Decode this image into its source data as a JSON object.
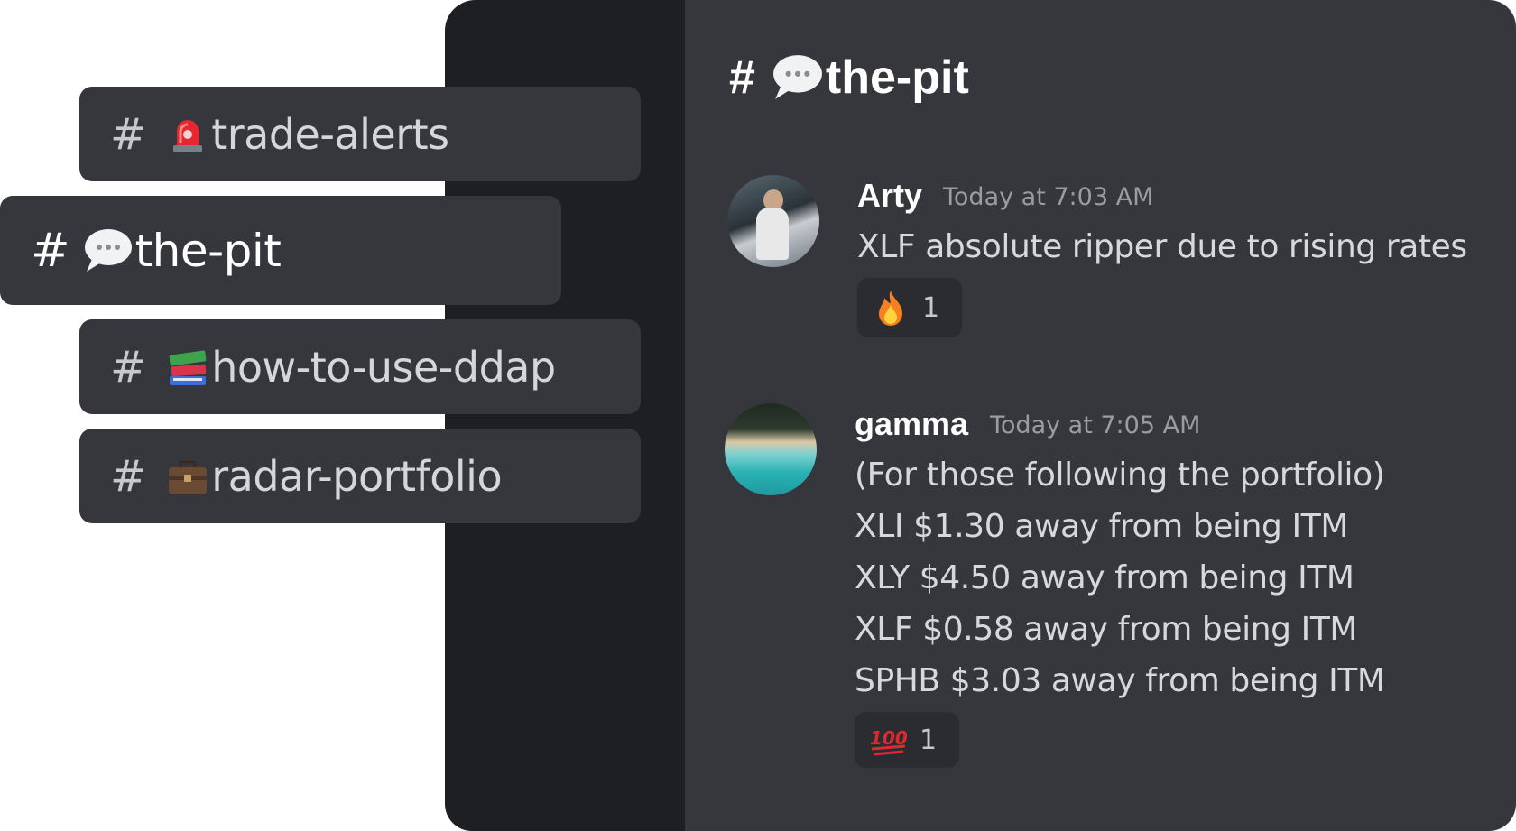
{
  "channels": [
    {
      "hash": "#",
      "icon": "rotating-light-icon",
      "label": "trade-alerts"
    },
    {
      "hash": "#",
      "icon": "speech-bubble-icon",
      "label": "the-pit",
      "active": true
    },
    {
      "hash": "#",
      "icon": "books-icon",
      "label": "how-to-use-ddap"
    },
    {
      "hash": "#",
      "icon": "briefcase-icon",
      "label": "radar-portfolio"
    }
  ],
  "header": {
    "hash": "#",
    "icon": "speech-bubble-icon",
    "title": "the-pit"
  },
  "messages": [
    {
      "author": "Arty",
      "timestamp": "Today at 7:03 AM",
      "lines": [
        "XLF absolute ripper due to rising rates"
      ],
      "reaction": {
        "icon": "fire-icon",
        "count": "1"
      }
    },
    {
      "author": "gamma",
      "timestamp": "Today at 7:05 AM",
      "lines": [
        "(For those following the portfolio)",
        "XLI $1.30 away from being ITM",
        "XLY $4.50 away from being ITM",
        "XLF $0.58 away from being ITM",
        "SPHB $3.03 away from being ITM"
      ],
      "reaction": {
        "icon": "hundred-points-icon",
        "count": "1"
      }
    }
  ],
  "colors": {
    "sidebar": "#1e1f22",
    "panel": "#36373d",
    "reaction_bg": "#2b2c31",
    "text": "#d7d8dc",
    "muted": "#9a9ca2"
  }
}
